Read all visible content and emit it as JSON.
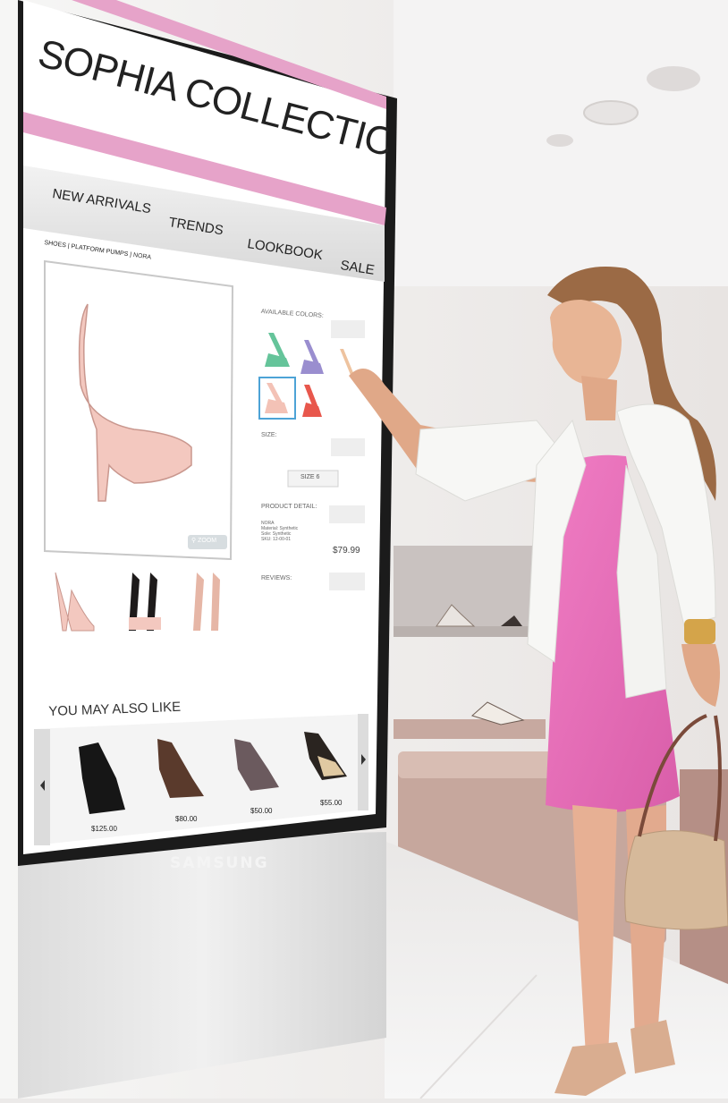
{
  "kiosk": {
    "title": "SOPHIA COLLECTION",
    "nav": [
      "NEW ARRIVALS",
      "TRENDS",
      "LOOKBOOK",
      "SALE"
    ],
    "breadcrumb": {
      "path": "SHOES | PLATFORM PUMPS |",
      "current": "NORA"
    },
    "available_colors_label": "AVAILABLE COLORS:",
    "size_label": "SIZE:",
    "size_value": "SIZE 6",
    "product_detail_label": "PRODUCT DETAIL:",
    "product_detail": {
      "name": "NORA",
      "material": "Material: Synthetic",
      "sole": "Sole: Synthetic",
      "sku": "SKU: 12-00-01"
    },
    "price": "$79.99",
    "reviews_label": "REVIEWS:",
    "zoom_label": "ZOOM",
    "also_like_label": "YOU MAY ALSO LIKE",
    "also_like_prices": [
      "$125.00",
      "$80.00",
      "$50.00",
      "$55.00"
    ],
    "device_brand": "SAMSUNG"
  },
  "colors": {
    "accent_pink": "#e6a3c9",
    "dress_pink": "#e46fb6",
    "bezel": "#1b1b1b"
  },
  "icons": {
    "prev": "chevron-left-icon",
    "next": "chevron-right-icon",
    "zoom": "magnifier-icon"
  }
}
